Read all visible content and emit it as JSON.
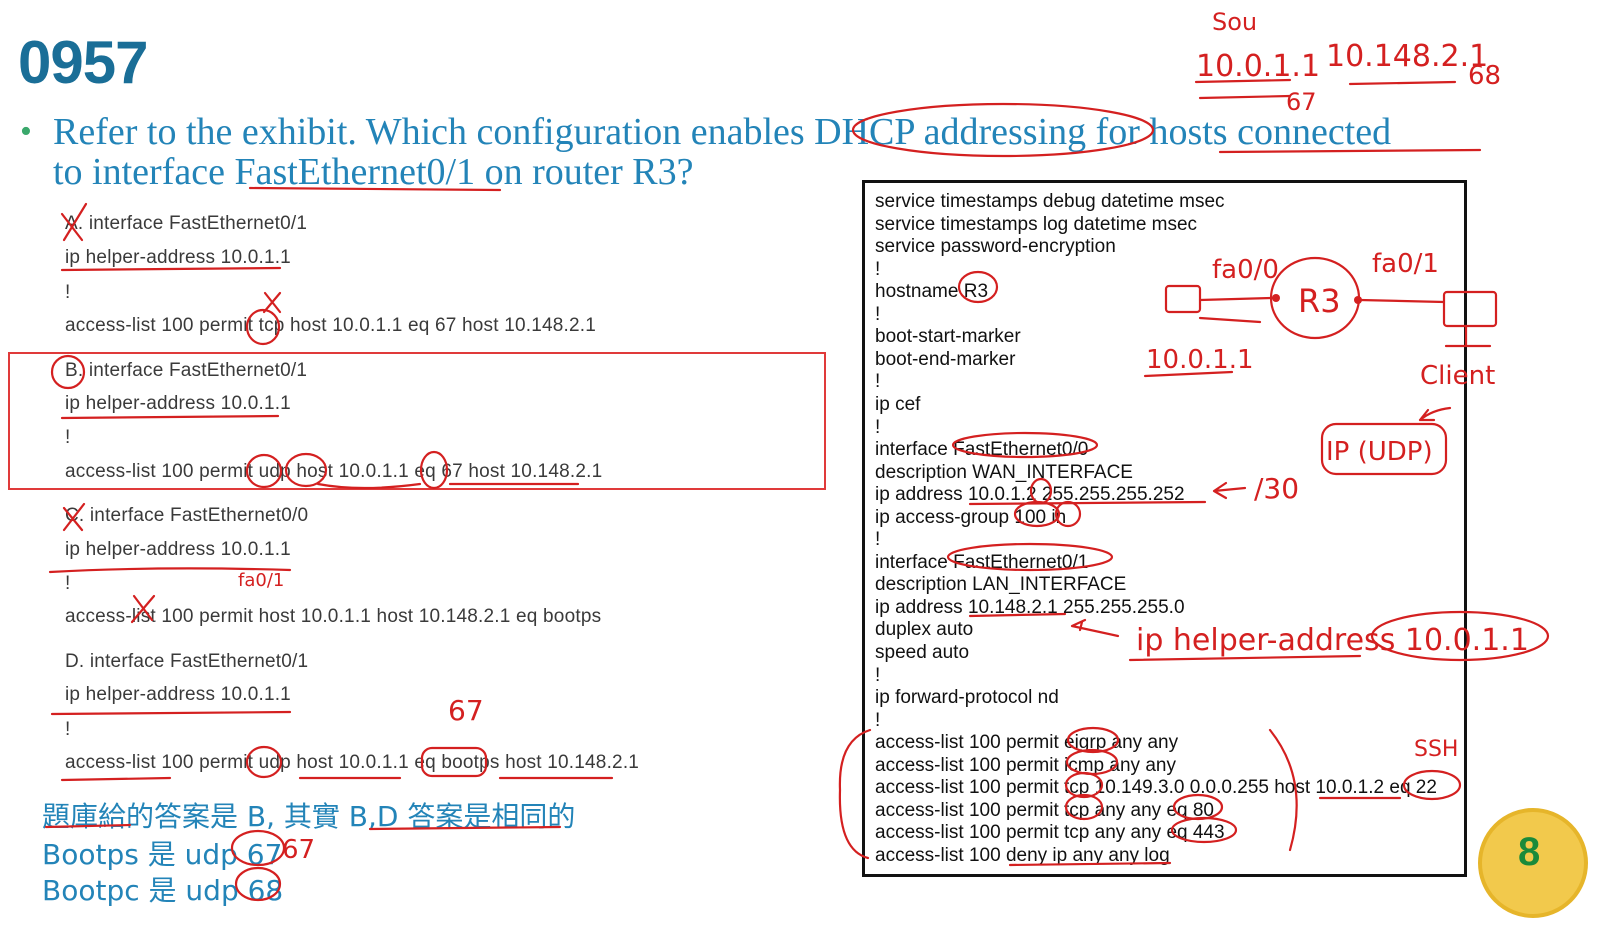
{
  "slide": {
    "title": "0957",
    "question_line1": "Refer to the exhibit. Which configuration enables DHCP addressing for hosts connected",
    "question_line2": "to interface FastEthernet0/1 on router R3?"
  },
  "options": {
    "a": {
      "line1": "A. interface FastEthernet0/1",
      "line2": "ip helper-address 10.0.1.1",
      "line3": "!",
      "line4": "access-list 100 permit tcp host 10.0.1.1 eq 67 host 10.148.2.1"
    },
    "b": {
      "line1": "B. interface FastEthernet0/1",
      "line2": "ip helper-address 10.0.1.1",
      "line3": "!",
      "line4": "access-list 100 permit udp host 10.0.1.1 eq 67 host 10.148.2.1"
    },
    "c": {
      "line1": "C. interface FastEthernet0/0",
      "line2": "ip helper-address 10.0.1.1",
      "line3": "!",
      "line4": "access-list 100 permit host 10.0.1.1 host 10.148.2.1 eq bootps"
    },
    "d": {
      "line1": "D. interface FastEthernet0/1",
      "line2": "ip helper-address 10.0.1.1",
      "line3": "!",
      "line4": "access-list 100 permit udp host 10.0.1.1 eq bootps host 10.148.2.1"
    }
  },
  "notes": {
    "line1": "題庫給的答案是 B, 其實 B,D 答案是相同的",
    "line2": "Bootps 是 udp 67",
    "line3": "Bootpc 是 udp 68"
  },
  "config": [
    "service timestamps debug datetime msec",
    "service timestamps log datetime msec",
    "service password-encryption",
    "!",
    "hostname R3",
    "!",
    "boot-start-marker",
    "boot-end-marker",
    "!",
    "ip cef",
    "!",
    "interface FastEthernet0/0",
    "description WAN_INTERFACE",
    "ip address 10.0.1.2 255.255.255.252",
    "ip access-group 100 in",
    "!",
    "interface FastEthernet0/1",
    "description LAN_INTERFACE",
    "ip address 10.148.2.1 255.255.255.0",
    "duplex auto",
    "speed auto",
    "!",
    "ip forward-protocol nd",
    "!",
    "access-list 100 permit eigrp any any",
    "access-list 100 permit icmp any any",
    "access-list 100 permit tcp 10.149.3.0 0.0.0.255 host 10.0.1.2 eq 22",
    "access-list 100 permit tcp any any eq 80",
    "access-list 100 permit tcp any any eq 443",
    "access-list 100 deny ip any any log"
  ],
  "annotations": {
    "src": "Sou",
    "ip_src": "10.0.1.1",
    "ip_dst": "10.148.2.1",
    "port_67": "67",
    "port_68": "68",
    "fa00": "fa0/0",
    "r3": "R3",
    "fa01": "fa0/1",
    "server_ip": "10.0.1.1",
    "client": "Client",
    "ip_udp": "IP (UDP)",
    "slash30": "/30",
    "helper": "ip helper-address 10.0.1.1",
    "ssh": "SSH",
    "fa01_c": "fa0/1",
    "port_67_d": "67",
    "note_67": "67"
  },
  "badge": {
    "number": "8"
  },
  "colors": {
    "title": "#1a6e97",
    "question": "#2384b8",
    "ink": "#d42020",
    "badge": "#f2c94c"
  }
}
